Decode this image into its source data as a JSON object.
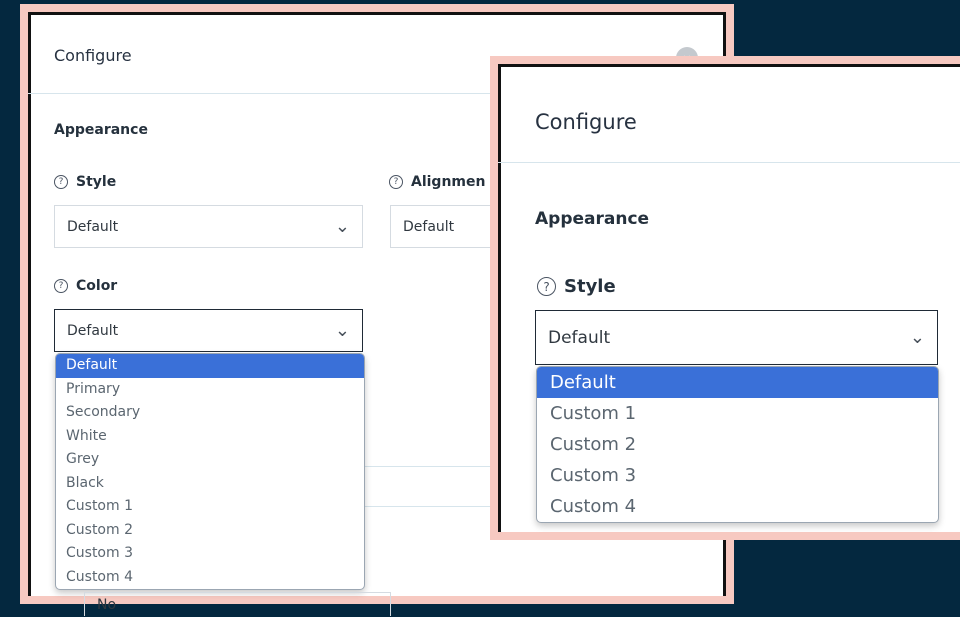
{
  "left_modal": {
    "title": "Configure",
    "close_icon": "×",
    "section": "Appearance",
    "style": {
      "label": "Style",
      "value": "Default"
    },
    "alignment": {
      "label": "Alignmen",
      "value": "Default"
    },
    "color": {
      "label": "Color",
      "value": "Default",
      "options": [
        "Default",
        "Primary",
        "Secondary",
        "White",
        "Grey",
        "Black",
        "Custom 1",
        "Custom 2",
        "Custom 3",
        "Custom 4"
      ]
    },
    "lower_select_value": "No"
  },
  "right_modal": {
    "title": "Configure",
    "section": "Appearance",
    "style": {
      "label": "Style",
      "value": "Default",
      "options": [
        "Default",
        "Custom 1",
        "Custom 2",
        "Custom 3",
        "Custom 4"
      ]
    }
  },
  "colors": {
    "background": "#04283f",
    "frame_highlight": "#f7c9c1",
    "selected_option": "#3a70d8"
  }
}
